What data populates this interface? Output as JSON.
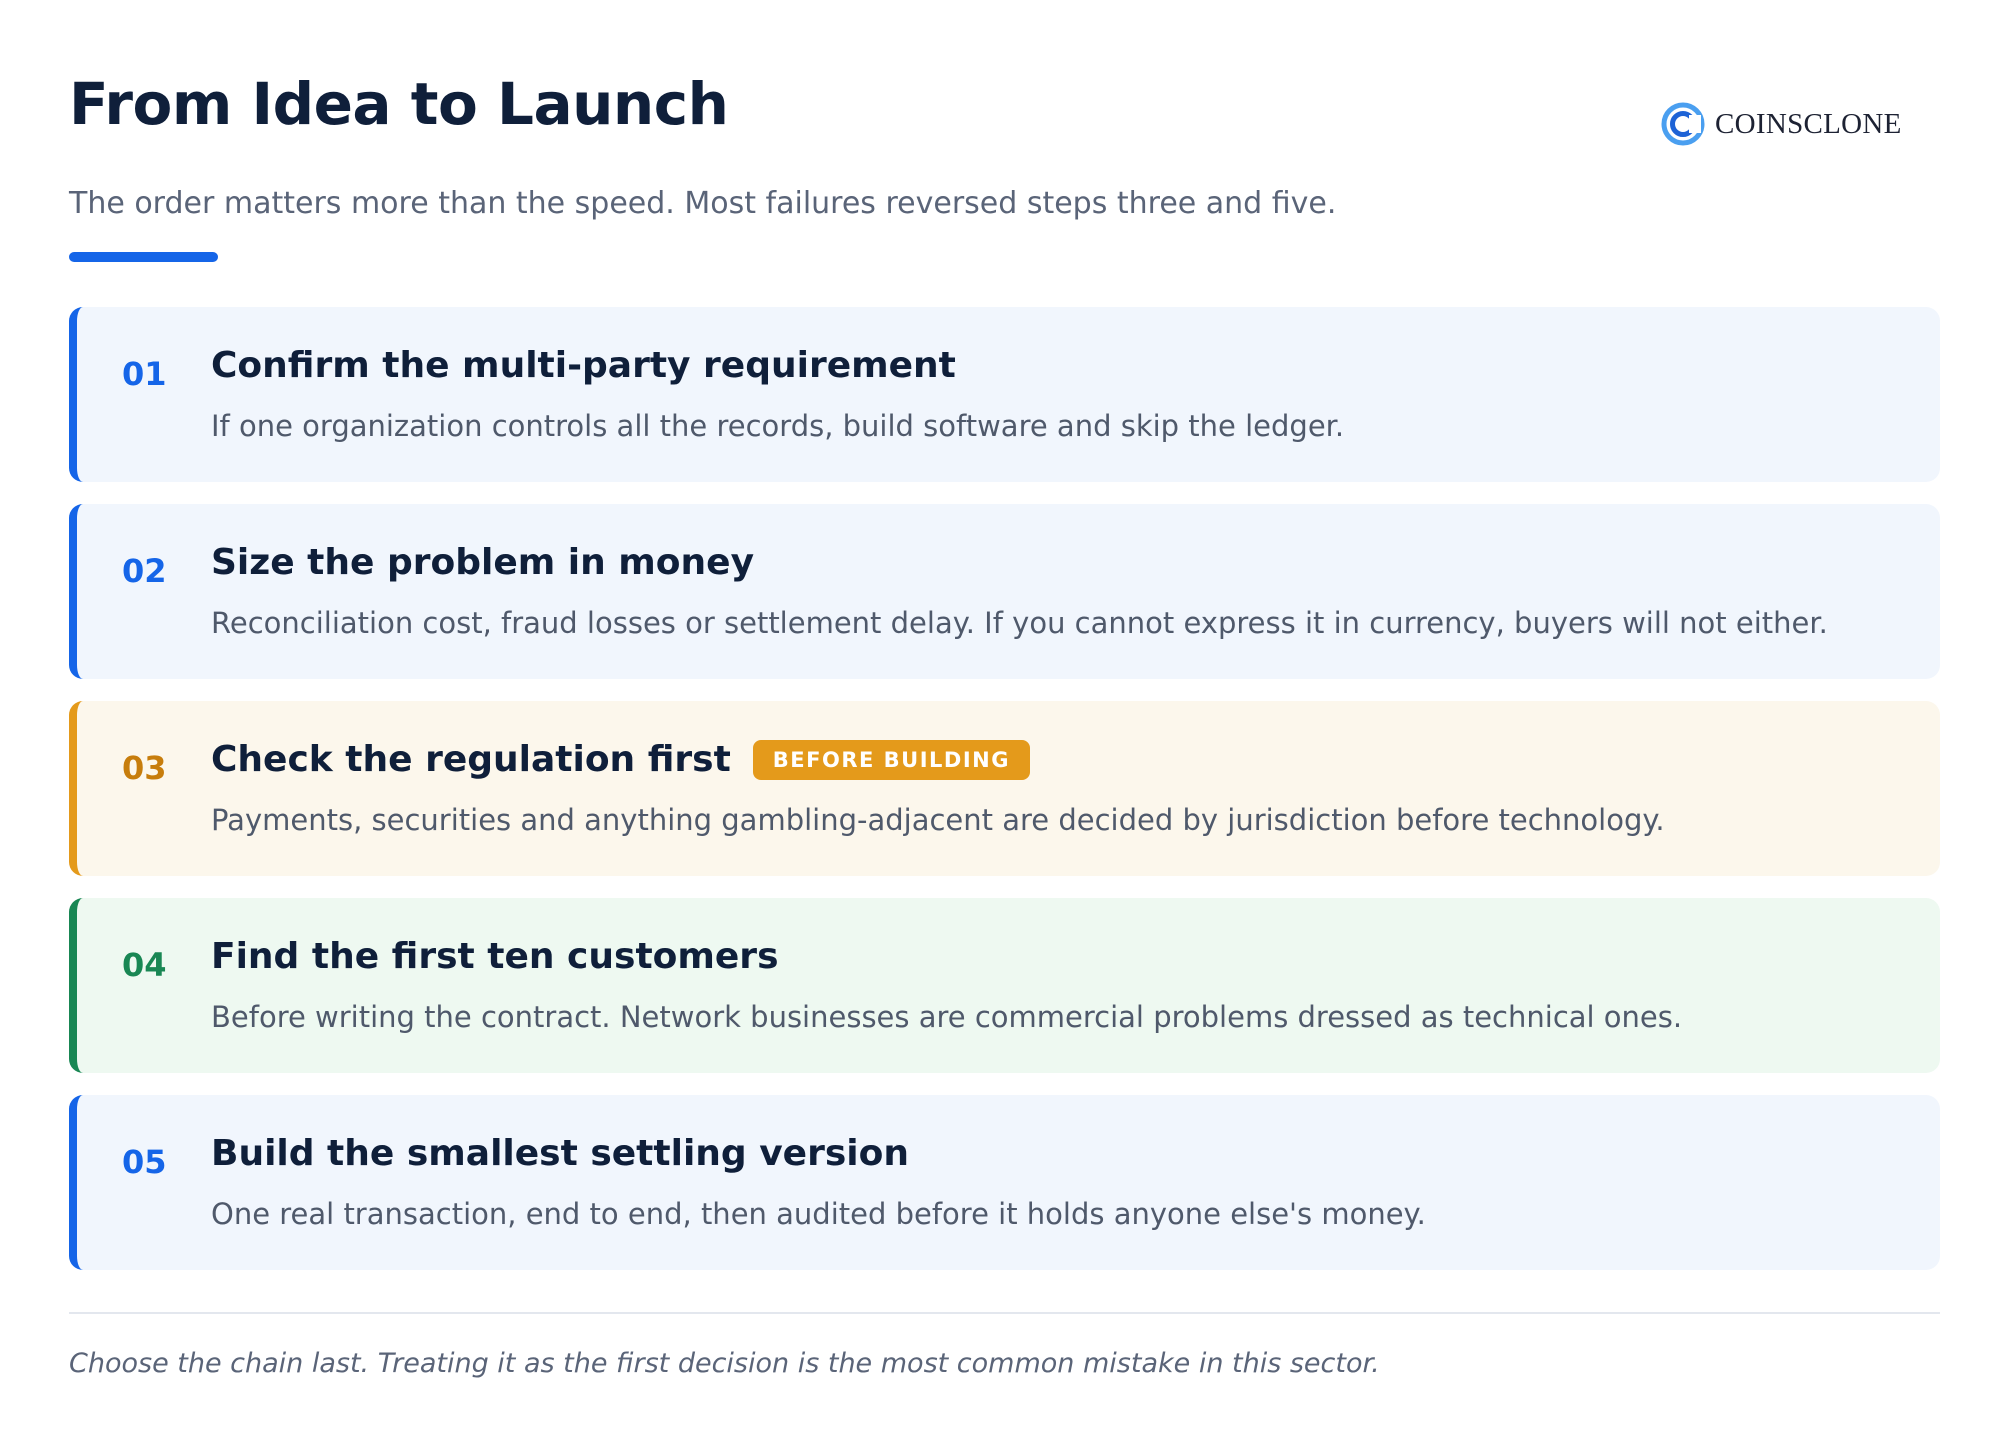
{
  "header": {
    "title": "From Idea to Launch",
    "subtitle": "The order matters more than the speed. Most failures reversed steps three and five.",
    "accent_color": "#1565e8"
  },
  "logo": {
    "text": "COINSCLONE",
    "icon": "coinsclone-logo-icon"
  },
  "steps": [
    {
      "number": "01",
      "title": "Confirm the multi-party requirement",
      "description": "If one organization controls all the records, build software and skip the ledger.",
      "tone": "default",
      "accent_color": "#1565e8"
    },
    {
      "number": "02",
      "title": "Size the problem in money",
      "description": "Reconciliation cost, fraud losses or settlement delay. If you cannot express it in currency, buyers will not either.",
      "tone": "default",
      "accent_color": "#1565e8"
    },
    {
      "number": "03",
      "title": "Check the regulation first",
      "badge": "BEFORE BUILDING",
      "description": "Payments, securities and anything gambling-adjacent are decided by jurisdiction before technology.",
      "tone": "warn",
      "accent_color": "#e49a1b"
    },
    {
      "number": "04",
      "title": "Find the first ten customers",
      "description": "Before writing the contract. Network businesses are commercial problems dressed as technical ones.",
      "tone": "ok",
      "accent_color": "#198754"
    },
    {
      "number": "05",
      "title": "Build the smallest settling version",
      "description": "One real transaction, end to end, then audited before it holds anyone else's money.",
      "tone": "default",
      "accent_color": "#1565e8"
    }
  ],
  "footer": {
    "note": "Choose the chain last. Treating it as the first decision is the most common mistake in this sector."
  }
}
